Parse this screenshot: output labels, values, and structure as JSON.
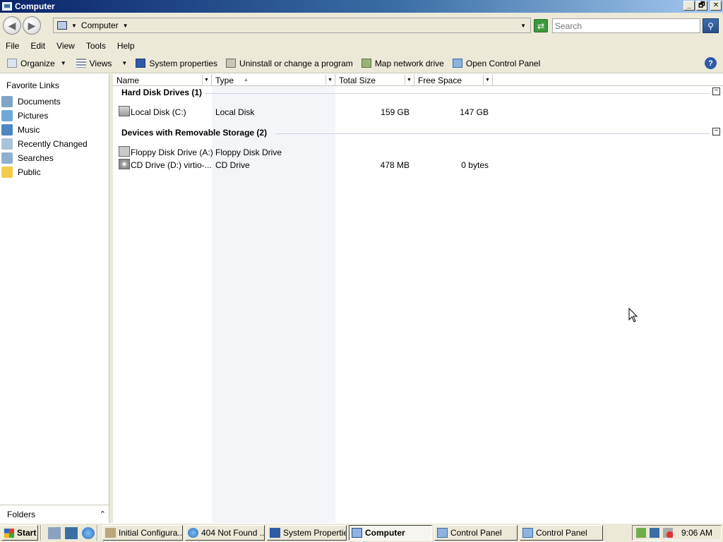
{
  "window": {
    "title": "Computer"
  },
  "titlebar_buttons": {
    "minimize": "_",
    "maximize": "🗗",
    "close": "✕"
  },
  "address": {
    "location": "Computer",
    "search_placeholder": "Search"
  },
  "menu": [
    "File",
    "Edit",
    "View",
    "Tools",
    "Help"
  ],
  "toolbar": {
    "organize": "Organize",
    "views": "Views",
    "system_properties": "System properties",
    "uninstall": "Uninstall or change a program",
    "map_drive": "Map network drive",
    "control_panel": "Open Control Panel"
  },
  "nav": {
    "heading": "Favorite Links",
    "items": [
      "Documents",
      "Pictures",
      "Music",
      "Recently Changed",
      "Searches",
      "Public"
    ],
    "folders_label": "Folders"
  },
  "columns": {
    "name": "Name",
    "type": "Type",
    "total": "Total Size",
    "free": "Free Space"
  },
  "groups": [
    {
      "title": "Hard Disk Drives (1)",
      "rows": [
        {
          "name": "Local Disk (C:)",
          "type": "Local Disk",
          "total": "159 GB",
          "free": "147 GB"
        }
      ]
    },
    {
      "title": "Devices with Removable Storage (2)",
      "rows": [
        {
          "name": "Floppy Disk Drive (A:)",
          "type": "Floppy Disk Drive",
          "total": "",
          "free": ""
        },
        {
          "name": "CD Drive (D:) virtio-...",
          "type": "CD Drive",
          "total": "478 MB",
          "free": "0 bytes"
        }
      ]
    }
  ],
  "taskbar": {
    "start": "Start",
    "tasks": [
      "Initial Configura...",
      "404 Not Found ...",
      "System Properties",
      "Computer",
      "Control Panel",
      "Control Panel"
    ],
    "clock": "9:06 AM"
  }
}
